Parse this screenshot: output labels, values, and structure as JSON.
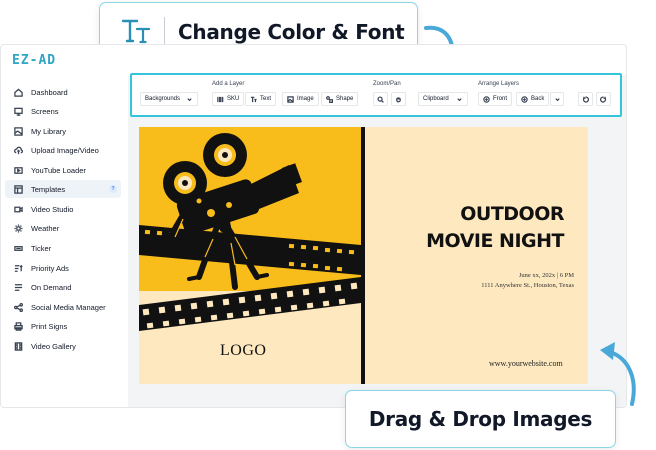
{
  "app": {
    "logo": "EZ-AD"
  },
  "sidebar": {
    "items": [
      {
        "label": "Dashboard",
        "icon": "home-icon"
      },
      {
        "label": "Screens",
        "icon": "monitor-icon"
      },
      {
        "label": "My Library",
        "icon": "image-icon"
      },
      {
        "label": "Upload Image/Video",
        "icon": "upload-cloud-icon"
      },
      {
        "label": "YouTube Loader",
        "icon": "video-icon"
      },
      {
        "label": "Templates",
        "icon": "template-icon",
        "active": true,
        "badge": "?"
      },
      {
        "label": "Video Studio",
        "icon": "camera-icon"
      },
      {
        "label": "Weather",
        "icon": "sun-icon"
      },
      {
        "label": "Ticker",
        "icon": "ticker-icon"
      },
      {
        "label": "Priority Ads",
        "icon": "sort-icon"
      },
      {
        "label": "On Demand",
        "icon": "list-icon"
      },
      {
        "label": "Social Media Manager",
        "icon": "share-icon"
      },
      {
        "label": "Print Signs",
        "icon": "print-icon"
      },
      {
        "label": "Video Gallery",
        "icon": "film-icon"
      }
    ]
  },
  "toolbar": {
    "backgrounds": "Backgrounds",
    "add_layer_label": "Add a Layer",
    "sku": "SKU",
    "text": "Text",
    "image": "Image",
    "shape": "Shape",
    "zoom_pan_label": "Zoom/Pan",
    "clipboard": "Clipboard",
    "arrange_label": "Arrange Layers",
    "front": "Front",
    "back": "Back"
  },
  "canvas": {
    "logo_text": "LOGO",
    "headline_1": "OUTDOOR",
    "headline_2": "MOVIE NIGHT",
    "date_line": "June xx, 202x | 6 PM",
    "address_line": "1111 Anywhere St., Houston, Texas",
    "website": "www.yourwebsite.com"
  },
  "callouts": {
    "top": "Change Color & Font",
    "bottom": "Drag & Drop Images"
  },
  "colors": {
    "accent": "#36c4dc",
    "poster_left": "#f9bd1b",
    "poster_right": "#fde8c0",
    "logo_color": "#2fa5c7",
    "arrow_color": "#4aa8d8"
  }
}
